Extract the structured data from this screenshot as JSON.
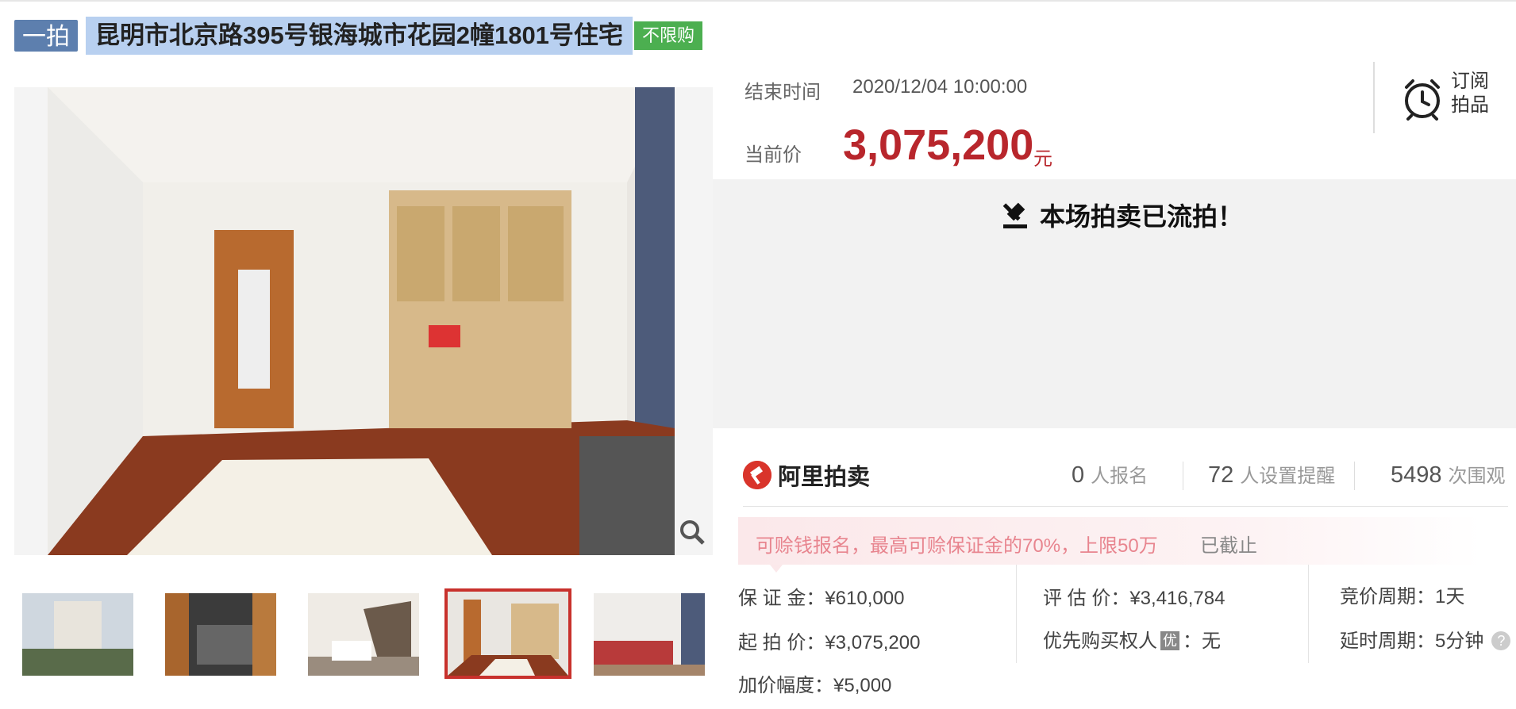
{
  "title": {
    "round_tag": "一拍",
    "text": "昆明市北京路395号银海城市花园2幢1801号住宅",
    "policy_tag": "不限购"
  },
  "auction": {
    "end_label": "结束时间",
    "end_value": "2020/12/04 10:00:00",
    "price_label": "当前价",
    "price_value": "3,075,200",
    "price_unit": "元",
    "subscribe_line1": "订阅",
    "subscribe_line2": "拍品",
    "status": "本场拍卖已流拍！"
  },
  "stats": {
    "brand": "阿里拍卖",
    "signups_num": "0",
    "signups_label": "人报名",
    "reminders_num": "72",
    "reminders_label": "人设置提醒",
    "views_num": "5498",
    "views_label": "次围观"
  },
  "notice": {
    "text": "可赊钱报名，最高可赊保证金的70%，上限50万",
    "state": "已截止"
  },
  "details": {
    "deposit": "保 证 金：¥610,000",
    "start_price": "起 拍 价：¥3,075,200",
    "increment": "加价幅度：¥5,000",
    "appraisal": "评 估 价：¥3,416,784",
    "priority_prefix": "优先购买权人",
    "priority_badge": "优",
    "priority_suffix": "：无",
    "bid_cycle": "竞价周期：1天",
    "extension_cycle": "延时周期：5分钟",
    "help_glyph": "?"
  },
  "icons": {
    "zoom": "magnifier-icon",
    "alarm": "alarm-clock-icon",
    "gavel": "gavel-icon",
    "brand": "auction-logo-icon"
  },
  "colors": {
    "accent_red": "#b8262c",
    "title_highlight": "#b8d0f0",
    "round_tag": "#5d7fae",
    "policy_tag": "#4caf50"
  }
}
